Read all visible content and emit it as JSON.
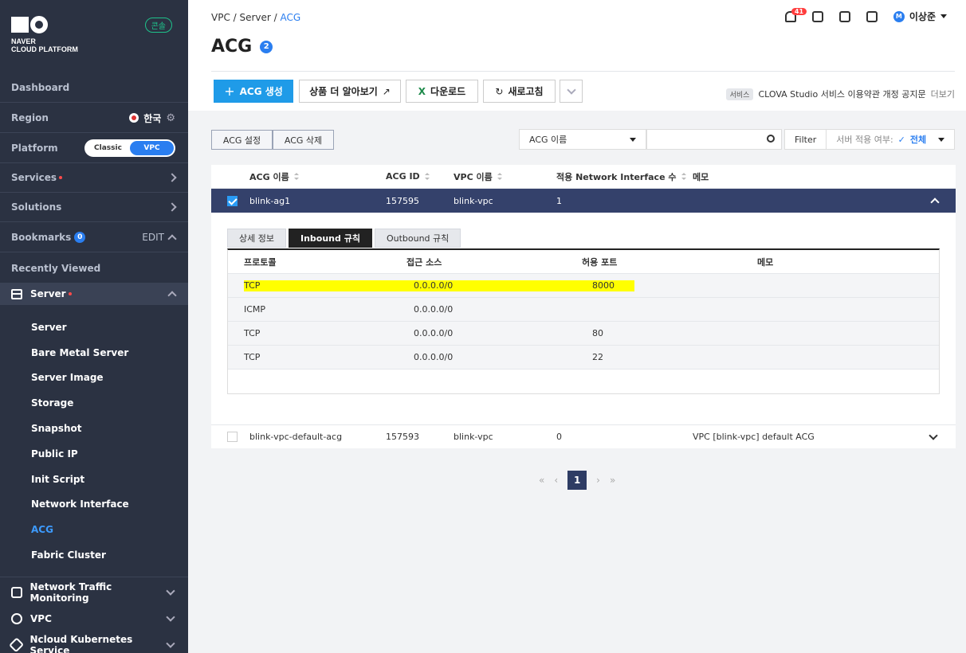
{
  "sidebar": {
    "logo_line1": "NAVER",
    "logo_line2": "CLOUD PLATFORM",
    "badge": "콘솔",
    "dashboard": "Dashboard",
    "region_label": "Region",
    "region_value": "한국",
    "platform_label": "Platform",
    "platform_options": [
      "Classic",
      "VPC"
    ],
    "services": "Services",
    "solutions": "Solutions",
    "bookmarks": "Bookmarks",
    "bookmarks_count": "0",
    "edit": "EDIT",
    "recently_viewed": "Recently Viewed",
    "server_group": "Server",
    "server_items": [
      "Server",
      "Bare Metal Server",
      "Server Image",
      "Storage",
      "Snapshot",
      "Public IP",
      "Init Script",
      "Network Interface",
      "ACG",
      "Fabric Cluster"
    ],
    "bottom_items": [
      "Network Traffic Monitoring",
      "VPC",
      "Ncloud Kubernetes Service"
    ]
  },
  "header": {
    "breadcrumb": [
      "VPC",
      "Server",
      "ACG"
    ],
    "title": "ACG",
    "title_count": "2",
    "notifications": "41",
    "user": "이상준",
    "user_initial": "M"
  },
  "toolbar": {
    "create": "ACG 생성",
    "learn_more": "상품 더 알아보기",
    "download": "다운로드",
    "refresh": "새로고침",
    "notice_tag": "서비스",
    "notice_text": "CLOVA Studio 서비스 이용약관 개정 공지문",
    "notice_more": "더보기"
  },
  "actions": {
    "settings": "ACG 설정",
    "delete": "ACG 삭제",
    "search_select": "ACG 이름",
    "search_value": "",
    "filter": "Filter",
    "filter_label": "서버 적용 여부:",
    "filter_value": "전체"
  },
  "table": {
    "columns": [
      "ACG 이름",
      "ACG ID",
      "VPC 이름",
      "적용 Network Interface 수",
      "메모"
    ],
    "rows": [
      {
        "name": "blink-ag1",
        "id": "157595",
        "vpc": "blink-vpc",
        "count": "1",
        "memo": ""
      },
      {
        "name": "blink-vpc-default-acg",
        "id": "157593",
        "vpc": "blink-vpc",
        "count": "0",
        "memo": "VPC [blink-vpc] default ACG"
      }
    ]
  },
  "detail": {
    "tabs": [
      "상세 정보",
      "Inbound 규칙",
      "Outbound 규칙"
    ],
    "columns": [
      "프로토콜",
      "접근 소스",
      "허용 포트",
      "메모"
    ],
    "rules": [
      {
        "protocol": "TCP",
        "source": "0.0.0.0/0",
        "port": "8000",
        "memo": ""
      },
      {
        "protocol": "ICMP",
        "source": "0.0.0.0/0",
        "port": "",
        "memo": ""
      },
      {
        "protocol": "TCP",
        "source": "0.0.0.0/0",
        "port": "80",
        "memo": ""
      },
      {
        "protocol": "TCP",
        "source": "0.0.0.0/0",
        "port": "22",
        "memo": ""
      }
    ]
  },
  "pager": {
    "current": "1"
  },
  "colors": {
    "sidebar_bg": "#2b3242",
    "accent": "#1f9be8",
    "selected_row": "#34416b",
    "highlight": "#ffff00"
  }
}
